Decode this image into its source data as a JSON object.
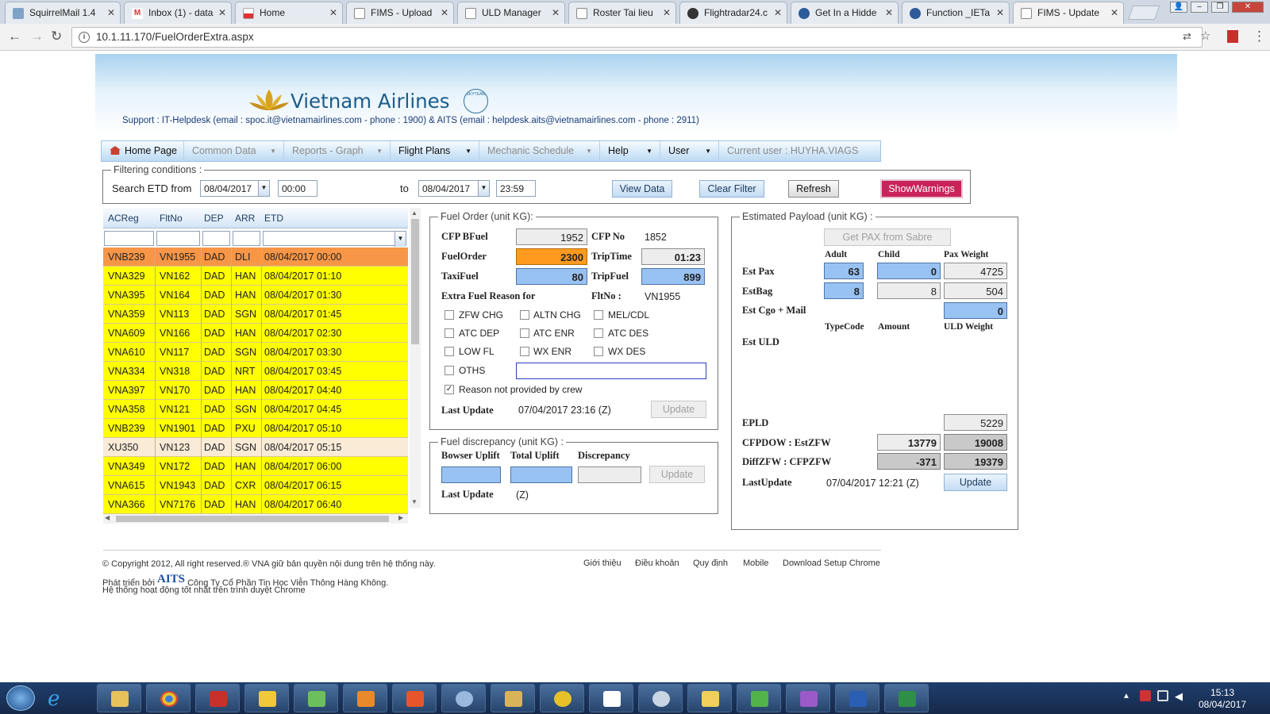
{
  "browser": {
    "tabs": [
      {
        "title": "SquirrelMail 1.4",
        "icon": "squirrelmail-icon"
      },
      {
        "title": "Inbox (1) - data",
        "icon": "gmail-icon"
      },
      {
        "title": "Home",
        "icon": "flag-icon"
      },
      {
        "title": "FIMS - Upload",
        "icon": "page-icon"
      },
      {
        "title": "ULD Manager",
        "icon": "page-icon"
      },
      {
        "title": "Roster Tai lieu",
        "icon": "page-icon"
      },
      {
        "title": "Flightradar24.c",
        "icon": "radar-icon"
      },
      {
        "title": "Get In a Hidde",
        "icon": "globe-icon"
      },
      {
        "title": "Function _IETa",
        "icon": "globe-icon"
      },
      {
        "title": "FIMS - Update",
        "icon": "page-icon"
      }
    ],
    "url": "10.1.11.170/FuelOrderExtra.aspx"
  },
  "header": {
    "brand": "Vietnam Airlines",
    "seal_text": "SKYTEAM",
    "support": "Support : IT-Helpdesk (email : spoc.it@vietnamairlines.com - phone : 1900) & AITS (email : helpdesk.aits@vietnamairlines.com - phone : 2911)"
  },
  "menu": {
    "home": "Home Page",
    "common": "Common Data",
    "reports": "Reports - Graph",
    "flight": "Flight Plans",
    "mechanic": "Mechanic Schedule",
    "help": "Help",
    "user": "User",
    "current": "Current user : HUYHA.VIAGS"
  },
  "filter": {
    "legend": "Filtering conditions :",
    "search_label": "Search ETD from",
    "from_date": "08/04/2017",
    "from_time": "00:00",
    "to_label": "to",
    "to_date": "08/04/2017",
    "to_time": "23:59",
    "view": "View Data",
    "clear": "Clear Filter",
    "refresh": "Refresh",
    "warnings": "ShowWarnings"
  },
  "grid": {
    "headers": [
      "ACReg",
      "FltNo",
      "DEP",
      "ARR",
      "ETD"
    ],
    "rows": [
      {
        "acreg": "VNB239",
        "flt": "VN1955",
        "dep": "DAD",
        "arr": "DLI",
        "etd": "08/04/2017 00:00",
        "color": "#f79646"
      },
      {
        "acreg": "VNA329",
        "flt": "VN162",
        "dep": "DAD",
        "arr": "HAN",
        "etd": "08/04/2017 01:10",
        "color": "#ffff00"
      },
      {
        "acreg": "VNA395",
        "flt": "VN164",
        "dep": "DAD",
        "arr": "HAN",
        "etd": "08/04/2017 01:30",
        "color": "#ffff00"
      },
      {
        "acreg": "VNA359",
        "flt": "VN113",
        "dep": "DAD",
        "arr": "SGN",
        "etd": "08/04/2017 01:45",
        "color": "#ffff00"
      },
      {
        "acreg": "VNA609",
        "flt": "VN166",
        "dep": "DAD",
        "arr": "HAN",
        "etd": "08/04/2017 02:30",
        "color": "#ffff00"
      },
      {
        "acreg": "VNA610",
        "flt": "VN117",
        "dep": "DAD",
        "arr": "SGN",
        "etd": "08/04/2017 03:30",
        "color": "#ffff00"
      },
      {
        "acreg": "VNA334",
        "flt": "VN318",
        "dep": "DAD",
        "arr": "NRT",
        "etd": "08/04/2017 03:45",
        "color": "#ffff00"
      },
      {
        "acreg": "VNA397",
        "flt": "VN170",
        "dep": "DAD",
        "arr": "HAN",
        "etd": "08/04/2017 04:40",
        "color": "#ffff00"
      },
      {
        "acreg": "VNA358",
        "flt": "VN121",
        "dep": "DAD",
        "arr": "SGN",
        "etd": "08/04/2017 04:45",
        "color": "#ffff00"
      },
      {
        "acreg": "VNB239",
        "flt": "VN1901",
        "dep": "DAD",
        "arr": "PXU",
        "etd": "08/04/2017 05:10",
        "color": "#ffff00"
      },
      {
        "acreg": "XU350",
        "flt": "VN123",
        "dep": "DAD",
        "arr": "SGN",
        "etd": "08/04/2017 05:15",
        "color": "#faebd7"
      },
      {
        "acreg": "VNA349",
        "flt": "VN172",
        "dep": "DAD",
        "arr": "HAN",
        "etd": "08/04/2017 06:00",
        "color": "#ffff00"
      },
      {
        "acreg": "VNA615",
        "flt": "VN1943",
        "dep": "DAD",
        "arr": "CXR",
        "etd": "08/04/2017 06:15",
        "color": "#ffff00"
      },
      {
        "acreg": "VNA366",
        "flt": "VN7176",
        "dep": "DAD",
        "arr": "HAN",
        "etd": "08/04/2017 06:40",
        "color": "#ffff00"
      }
    ]
  },
  "fuel": {
    "legend": "Fuel Order (unit KG):",
    "cfp_bfuel_label": "CFP BFuel",
    "cfp_bfuel": "1952",
    "cfp_no_label": "CFP No",
    "cfp_no": "1852",
    "fuel_order_label": "FuelOrder",
    "fuel_order": "2300",
    "trip_time_label": "TripTime",
    "trip_time": "01:23",
    "taxi_label": "TaxiFuel",
    "taxi": "80",
    "trip_fuel_label": "TripFuel",
    "trip_fuel": "899",
    "extra_label": "Extra Fuel Reason for",
    "flt_label": "FltNo :",
    "flt": "VN1955",
    "reasons": [
      "ZFW CHG",
      "ALTN CHG",
      "MEL/CDL",
      "ATC DEP",
      "ATC ENR",
      "ATC DES",
      "LOW FL",
      "WX ENR",
      "WX DES"
    ],
    "oths": "OTHS",
    "not_provided": "Reason not provided by crew",
    "last_update_label": "Last Update",
    "last_update": "07/04/2017 23:16 (Z)",
    "update": "Update"
  },
  "discrepancy": {
    "legend": "Fuel discrepancy (unit KG) :",
    "bowser": "Bowser Uplift",
    "total": "Total Uplift",
    "disc": "Discrepancy",
    "update": "Update",
    "last_label": "Last Update",
    "last": "(Z)"
  },
  "payload": {
    "legend": "Estimated Payload (unit KG) :",
    "get_pax": "Get PAX from Sabre",
    "adult": "Adult",
    "child": "Child",
    "pax_weight": "Pax Weight",
    "est_pax_label": "Est Pax",
    "pax_adult": "63",
    "pax_child": "0",
    "pax_weight_val": "4725",
    "est_bag_label": "EstBag",
    "bag_1": "8",
    "bag_2": "8",
    "bag_3": "504",
    "cgo_label": "Est Cgo + Mail",
    "cgo": "0",
    "type_code": "TypeCode",
    "amount": "Amount",
    "uld_weight": "ULD Weight",
    "uld_label": "Est ULD",
    "epld_label": "EPLD",
    "epld": "5229",
    "cfpdow_label": "CFPDOW : EstZFW",
    "cfpdow": "13779",
    "estzfw": "19008",
    "diff_label": "DiffZFW : CFPZFW",
    "diff": "-371",
    "cfpzfw": "19379",
    "last_label": "LastUpdate",
    "last": "07/04/2017 12:21 (Z)",
    "update": "Update"
  },
  "footer": {
    "copyright": "© Copyright 2012, All right reserved.® VNA giữ bản quyền nội dung trên hệ thống này.",
    "dev_prefix": "Phát triển bởi",
    "aits": "AITS",
    "company": "Công Ty Cổ Phần Tin Học Viễn Thông Hàng Không.",
    "browser_note": "Hệ thống hoạt động tốt nhất trên trình duyệt Chrome",
    "links": [
      "Giới thiệu",
      "Điều khoản",
      "Quy định",
      "Mobile",
      "Download Setup Chrome"
    ]
  },
  "taskbar": {
    "time": "15:13",
    "date": "08/04/2017"
  },
  "colors": {
    "row_selected": "#f79646",
    "row_normal": "#ffff00",
    "row_alt": "#faebd7",
    "warn_button": "#c9235a",
    "brand_blue": "#1c5d8c"
  }
}
